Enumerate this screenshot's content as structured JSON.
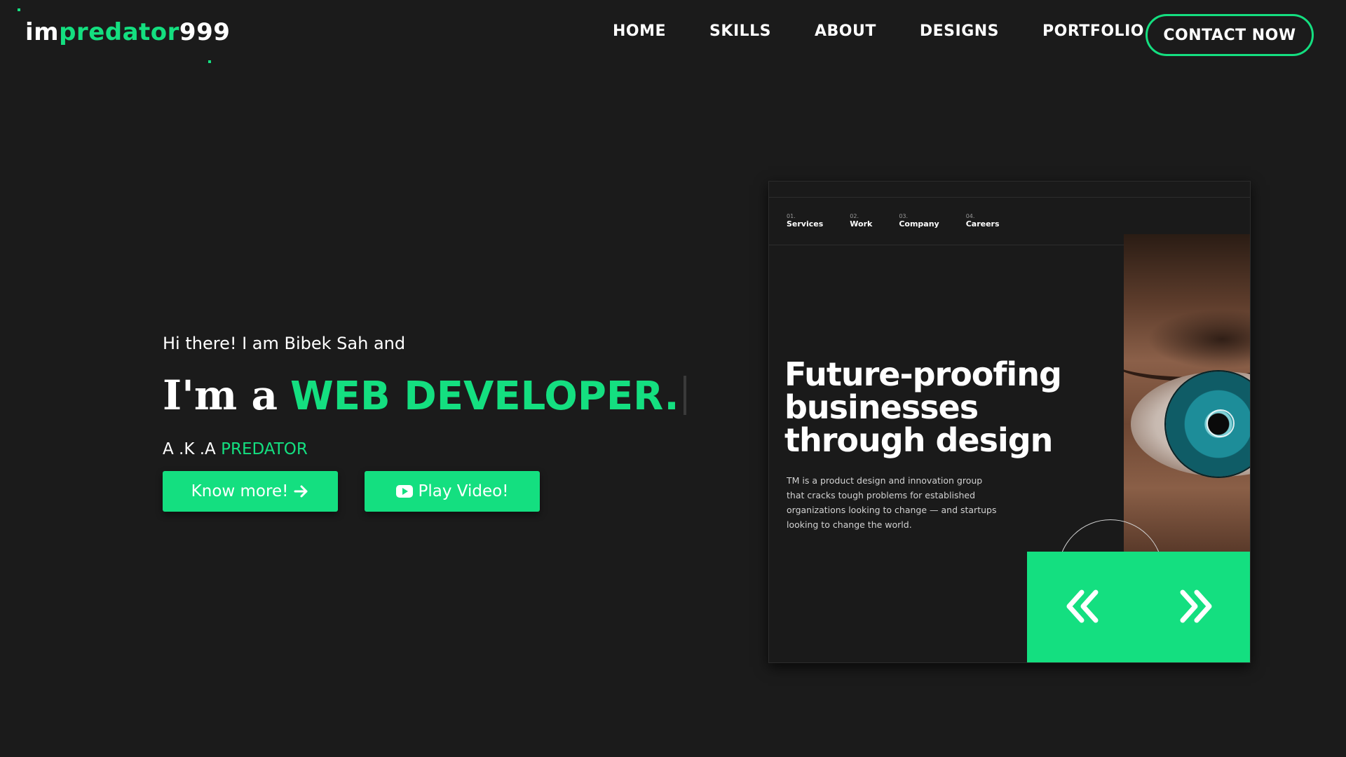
{
  "brand": {
    "logo_prefix": "im",
    "logo_highlight": "predator",
    "logo_suffix": "999",
    "accent_color": "#14df80",
    "background_color": "#1b1b1b"
  },
  "nav": {
    "items": [
      {
        "label": "HOME"
      },
      {
        "label": "SKILLS"
      },
      {
        "label": "ABOUT"
      },
      {
        "label": "DESIGNS"
      },
      {
        "label": "PORTFOLIO"
      }
    ],
    "cta_label": "CONTACT NOW"
  },
  "hero": {
    "greeting": "Hi there! I am Bibek Sah and",
    "headline_prefix": "I'm a",
    "headline_role": "WEB DEVELOPER.",
    "aka_prefix": "A .K .A",
    "aka_name": "PREDATOR",
    "know_more_label": "Know more!",
    "know_more_icon": "arrow-right-icon",
    "play_video_label": "Play Video!",
    "play_video_icon": "youtube-icon"
  },
  "showcase": {
    "nav": [
      {
        "num": "01.",
        "label": "Services"
      },
      {
        "num": "02.",
        "label": "Work"
      },
      {
        "num": "03.",
        "label": "Company"
      },
      {
        "num": "04.",
        "label": "Careers"
      }
    ],
    "title": "Future-proofing businesses through design",
    "description": "TM is a product design and innovation group that cracks tough problems for established organizations looking to change — and startups looking to change the world.",
    "prev_icon": "double-chevron-left-icon",
    "next_icon": "double-chevron-right-icon"
  }
}
